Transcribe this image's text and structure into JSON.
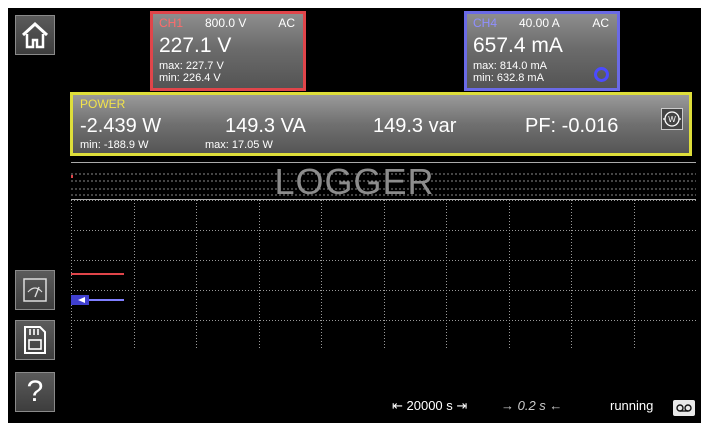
{
  "channels": [
    {
      "name": "CH1",
      "range": "800.0 V",
      "coupling": "AC",
      "value": "227.1 V",
      "max": "max: 227.7 V",
      "min": "min: 226.4 V",
      "color": "#e0454a"
    },
    {
      "name": "CH4",
      "range": "40.00 A",
      "coupling": "AC",
      "value": "657.4 mA",
      "max": "max: 814.0 mA",
      "min": "min: 632.8 mA",
      "color": "#6a6ae6"
    }
  ],
  "power": {
    "title": "POWER",
    "active": "-2.439 W",
    "apparent": "149.3 VA",
    "reactive": "149.3 var",
    "pf": "PF: -0.016",
    "active_min": "min: -188.9 W",
    "apparent_max": "max: 17.05 W",
    "border_color": "#dede3a"
  },
  "logger": {
    "title": "LOGGER",
    "timespan": "⇤ 20000 s ⇥",
    "interval": "→ 0.2 s ←",
    "status": "running"
  },
  "icons": {
    "home": "home-icon",
    "meter": "analog-meter-icon",
    "save": "sd-card-icon",
    "help": "help-icon",
    "power_mode": "wattmeter-icon",
    "record": "tape-record-icon"
  },
  "help_glyph": "?",
  "power_icon_glyph": "W"
}
